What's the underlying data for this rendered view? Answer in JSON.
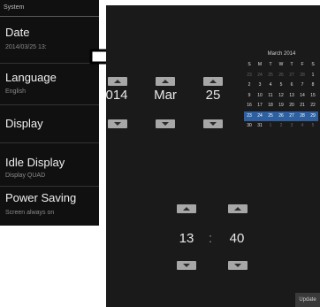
{
  "settings": {
    "header": "System",
    "items": [
      {
        "label": "Date",
        "sub": "2014/03/25 13:"
      },
      {
        "label": "Language",
        "sub": "English"
      },
      {
        "label": "Display",
        "sub": ""
      },
      {
        "label": "Idle Display",
        "sub": "Display QUAD"
      },
      {
        "label": "Power Saving",
        "sub": "Screen always on"
      }
    ]
  },
  "picker": {
    "year": "014",
    "month": "Mar",
    "day": "25",
    "hour": "13",
    "separator": ":",
    "minute": "40",
    "update_label": "Update"
  },
  "calendar": {
    "title": "March 2014",
    "weekdays": [
      "S",
      "M",
      "T",
      "W",
      "T",
      "F",
      "S"
    ],
    "weeks": [
      [
        "23",
        "24",
        "25",
        "26",
        "27",
        "28",
        "1"
      ],
      [
        "2",
        "3",
        "4",
        "5",
        "6",
        "7",
        "8"
      ],
      [
        "9",
        "10",
        "11",
        "12",
        "13",
        "14",
        "15"
      ],
      [
        "16",
        "17",
        "18",
        "19",
        "20",
        "21",
        "22"
      ],
      [
        "23",
        "24",
        "25",
        "26",
        "27",
        "28",
        "29"
      ],
      [
        "30",
        "31",
        "1",
        "2",
        "3",
        "4",
        "5"
      ]
    ],
    "dim_cells": [
      [
        0,
        0
      ],
      [
        0,
        1
      ],
      [
        0,
        2
      ],
      [
        0,
        3
      ],
      [
        0,
        4
      ],
      [
        0,
        5
      ],
      [
        5,
        2
      ],
      [
        5,
        3
      ],
      [
        5,
        4
      ],
      [
        5,
        5
      ],
      [
        5,
        6
      ]
    ],
    "highlight_week": 4,
    "highlight_color": "#2e5fa0"
  },
  "colors": {
    "panel_bg": "#1a1a1a",
    "settings_bg": "#101010",
    "spin_button": "#a7a7a7"
  }
}
